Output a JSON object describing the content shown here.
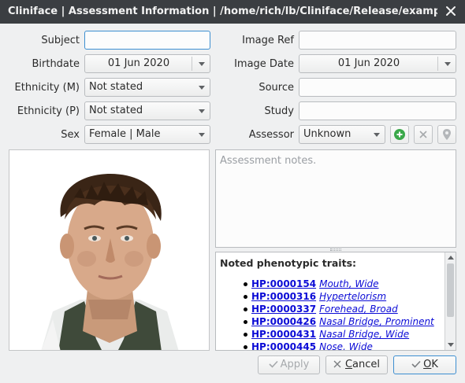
{
  "window": {
    "title": "Cliniface | Assessment Information | /home/rich/lb/Cliniface/Release/examples/max_ra...",
    "close_icon": "close-icon"
  },
  "form": {
    "subject": {
      "label": "Subject",
      "value": ""
    },
    "birthdate": {
      "label": "Birthdate",
      "value": "01 Jun 2020"
    },
    "ethnicity_m": {
      "label": "Ethnicity (M)",
      "value": "Not stated"
    },
    "ethnicity_p": {
      "label": "Ethnicity (P)",
      "value": "Not stated"
    },
    "sex": {
      "label": "Sex",
      "value": "Female | Male"
    },
    "image_ref": {
      "label": "Image Ref",
      "value": ""
    },
    "image_date": {
      "label": "Image Date",
      "value": "01 Jun 2020"
    },
    "source": {
      "label": "Source",
      "value": ""
    },
    "study": {
      "label": "Study",
      "value": ""
    },
    "assessor": {
      "label": "Assessor",
      "value": "Unknown"
    }
  },
  "assessor_buttons": {
    "add_icon": "add-icon",
    "remove_icon": "remove-icon",
    "location_icon": "location-pin-icon"
  },
  "notes": {
    "placeholder": "Assessment notes.",
    "value": ""
  },
  "traits": {
    "heading": "Noted phenotypic traits:",
    "items": [
      {
        "code": "HP:0000154",
        "name": "Mouth, Wide"
      },
      {
        "code": "HP:0000316",
        "name": "Hypertelorism"
      },
      {
        "code": "HP:0000337",
        "name": "Forehead, Broad"
      },
      {
        "code": "HP:0000426",
        "name": "Nasal Bridge, Prominent"
      },
      {
        "code": "HP:0000431",
        "name": "Nasal Bridge, Wide"
      },
      {
        "code": "HP:0000445",
        "name": "Nose, Wide"
      }
    ]
  },
  "buttons": {
    "apply": "Apply",
    "cancel_pre": "",
    "cancel_u": "C",
    "cancel_post": "ancel",
    "ok_pre": "",
    "ok_u": "O",
    "ok_post": "K"
  },
  "colors": {
    "titlebar": "#3b3e42",
    "focus": "#3d8fd1",
    "link": "#0b0bd6",
    "add_green": "#3aa84a"
  }
}
